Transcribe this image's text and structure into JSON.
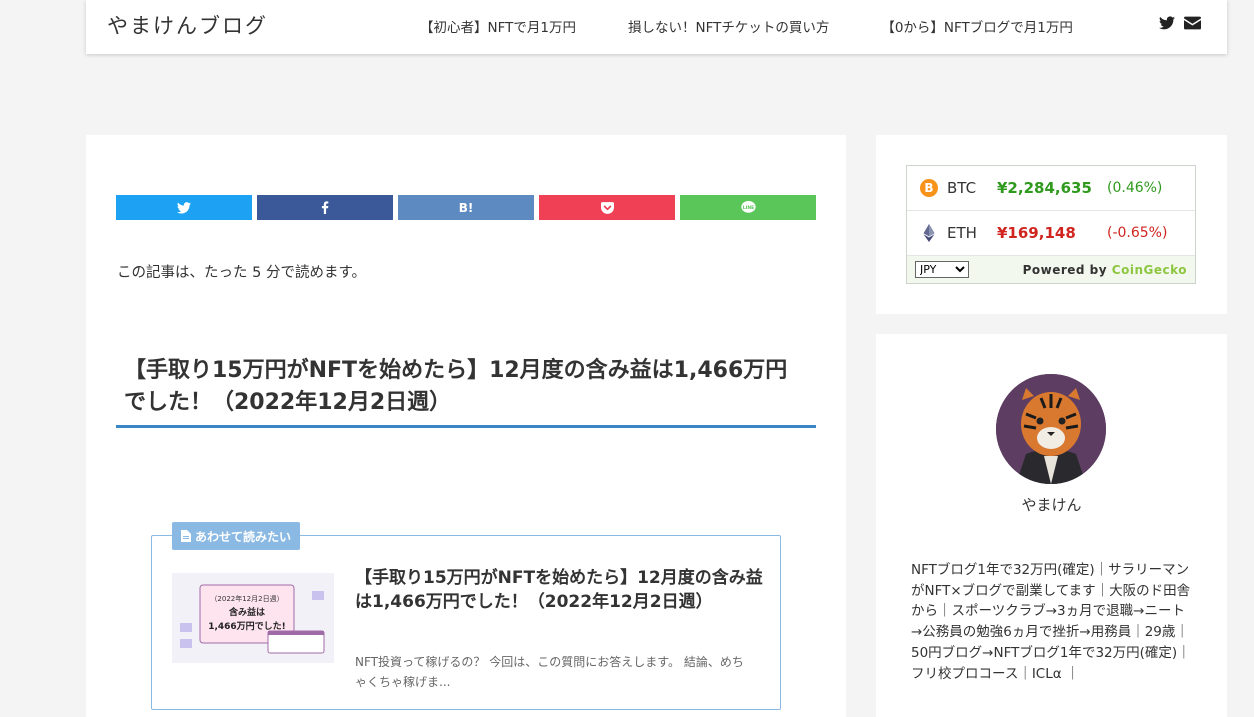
{
  "header": {
    "site_title": "やまけんブログ",
    "nav": [
      "【初心者】NFTで月1万円",
      "損しない！NFTチケットの買い方",
      "【0から】NFTブログで月1万円"
    ]
  },
  "share": {
    "hatena_label": "B!"
  },
  "article": {
    "read_time": "この記事は、たった 5 分で読めます。",
    "title": "【手取り15万円がNFTを始めたら】12月度の含み益は1,466万円でした！（2022年12月2日週）",
    "blogcard": {
      "label": "あわせて読みたい",
      "title": "【手取り15万円がNFTを始めたら】12月度の含み益は1,466万円でした！（2022年12月2日週）",
      "excerpt": "NFT投資って稼げるの？ 今回は、この質問にお答えします。 結論、めちゃくちゃ稼げま...",
      "thumb": {
        "line1": "（2022年12月2日週）",
        "line2": "含み益は",
        "line3": "1,466万円でした!"
      }
    }
  },
  "coin_widget": {
    "rows": [
      {
        "symbol": "BTC",
        "price": "¥2,284,635",
        "change": "(0.46%)",
        "direction": "up"
      },
      {
        "symbol": "ETH",
        "price": "¥169,148",
        "change": "(-0.65%)",
        "direction": "down"
      }
    ],
    "currency": "JPY",
    "powered_prefix": "Powered by ",
    "powered_brand": "CoinGecko"
  },
  "profile": {
    "name": "やまけん",
    "description": "NFTブログ1年で32万円(確定)｜サラリーマンがNFT×ブログで副業してます｜大阪のド田舎から｜スポーツクラブ→3ヵ月で退職→ニート→公務員の勉強6ヵ月で挫折→用務員｜29歳｜50円ブログ→NFTブログ1年で32万円(確定)｜フリ校プロコース｜ICLα ｜"
  },
  "colors": {
    "accent": "#3a86c6",
    "card_border": "#8ab9e3",
    "up": "#2f9a1d",
    "down": "#d0241f"
  }
}
